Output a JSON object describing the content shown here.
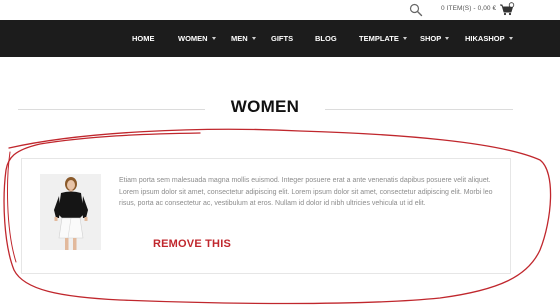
{
  "header": {
    "cart_text": "0 ITEM(S) - 0,00 €",
    "search_icon": "search-icon",
    "cart_icon": "shopping-cart-icon"
  },
  "nav": {
    "items": [
      {
        "label": "HOME",
        "has_caret": false
      },
      {
        "label": "WOMEN",
        "has_caret": true
      },
      {
        "label": "MEN",
        "has_caret": true
      },
      {
        "label": "GIFTS",
        "has_caret": false
      },
      {
        "label": "BLOG",
        "has_caret": false
      },
      {
        "label": "TEMPLATE",
        "has_caret": true
      },
      {
        "label": "SHOP",
        "has_caret": true
      },
      {
        "label": "HIKASHOP",
        "has_caret": true
      }
    ]
  },
  "page": {
    "title": "WOMEN"
  },
  "product": {
    "description": "Etiam porta sem malesuada magna mollis euismod. Integer posuere erat a ante venenatis dapibus posuere velit aliquet. Lorem ipsum dolor sit amet, consectetur adipiscing elit. Lorem ipsum dolor sit amet, consectetur adipiscing elit. Morbi leo risus, porta ac consectetur ac, vestibulum at eros. Nullam id dolor id nibh ultricies vehicula ut id elit.",
    "annotation_text": "REMOVE THIS"
  },
  "colors": {
    "navbar_bg": "#1c1c1c",
    "annotation_red": "#c0272d",
    "text_muted": "#8c8c8c"
  }
}
